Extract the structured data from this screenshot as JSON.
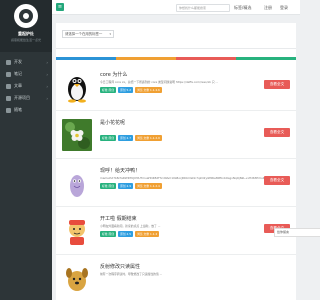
{
  "brand": {
    "name": "重起炉灶",
    "subtitle": "感恩和能给生活一点光"
  },
  "nav": [
    {
      "label": "开发"
    },
    {
      "label": "笔记"
    },
    {
      "label": "文章"
    },
    {
      "label": "开源项目"
    },
    {
      "label": "随笔"
    }
  ],
  "header": {
    "toggle_icon": "≡",
    "search_placeholder": "你想找什么都能搜索",
    "links": [
      "标签/精选",
      "注册",
      "登录"
    ]
  },
  "panel": {
    "select_value": "请选择一个在用的标签一",
    "stripe_colors": [
      "#2b93d6",
      "#f0a033",
      "#e85b57",
      "#27b27e"
    ]
  },
  "items": [
    {
      "title": "core 为什么",
      "desc": "今日工程师 core xx，总结一下所遇到的 core 类型问题说明 https://deffe.com/reso/xk 只 ...",
      "tags": [
        "标准 原创",
        "原创 5.2",
        "浏览 文章 1.1.4.6"
      ],
      "button": "查看全文"
    },
    {
      "title": "是小花花呢",
      "desc": "",
      "tags": [
        "标准 原创",
        "原创 2.7",
        "浏览 文章 1.1.2.9"
      ],
      "button": "查看全文"
    },
    {
      "title": "现呼！给天冲鸭！",
      "desc": "mameihd7b8cfaDWR7KJ03IUTmuaHD4B2F3cd9Am10LBocJIROmIsDn7qkO2ylW0Ke80fKnbOsgvNqOjNkL+xHd63PrCuKfW3kUx0",
      "tags": [
        "标准 原创",
        "原创 2.9",
        "浏览 文章 1.1.2.4"
      ],
      "button": "查看全文"
    },
    {
      "title": "开工啦 假期结束",
      "desc": "小明在外面看新闻，新家的点点 上班啦，放了 ...",
      "tags": [
        "标准 原创",
        "原创 2.5",
        "浏览 文章 1.1.4"
      ],
      "button": "查看全文"
    },
    {
      "title": "反射修改只读属性",
      "desc": "前有一次程序调试时，导致修改了只读属性的值 ...",
      "tags": [],
      "button": ""
    }
  ],
  "chat": {
    "label": "给你留言"
  }
}
